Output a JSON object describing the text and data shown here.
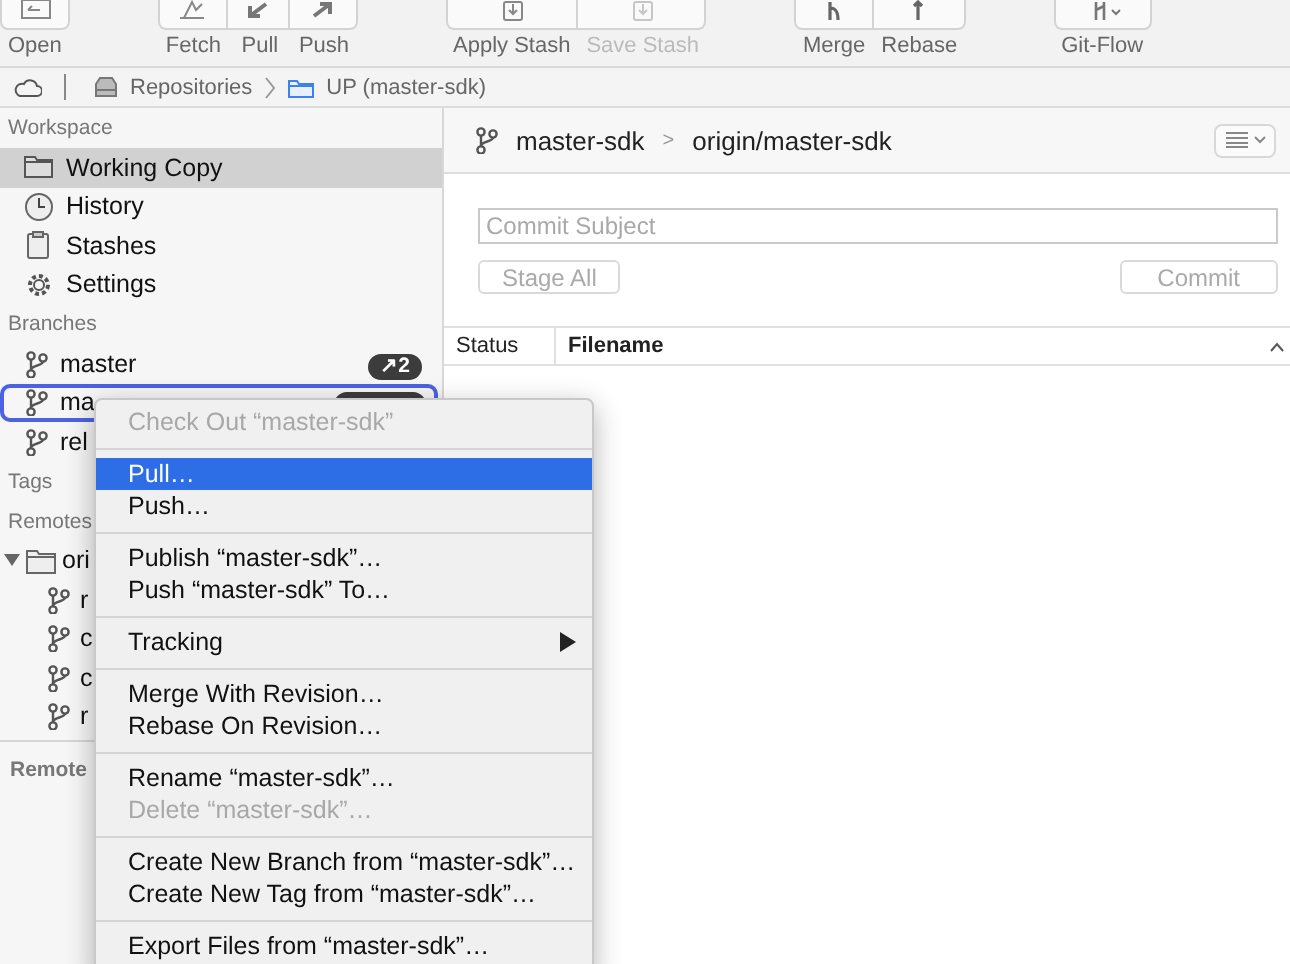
{
  "toolbar": {
    "groups": [
      {
        "buttons": [
          {
            "kind": "open",
            "label": "Open",
            "disabled": false
          }
        ]
      },
      {
        "buttons": [
          {
            "kind": "fetch",
            "label": "Fetch",
            "disabled": false
          },
          {
            "kind": "pull",
            "label": "Pull",
            "disabled": false
          },
          {
            "kind": "push",
            "label": "Push",
            "disabled": false
          }
        ]
      },
      {
        "buttons": [
          {
            "kind": "stash",
            "label": "Apply Stash",
            "disabled": false
          },
          {
            "kind": "stash",
            "label": "Save Stash",
            "disabled": true
          }
        ]
      },
      {
        "buttons": [
          {
            "kind": "merge",
            "label": "Merge",
            "disabled": false
          },
          {
            "kind": "rebase",
            "label": "Rebase",
            "disabled": false
          }
        ]
      },
      {
        "buttons": [
          {
            "kind": "gitflow",
            "label": "Git-Flow",
            "disabled": false
          }
        ]
      }
    ]
  },
  "breadcrumb": {
    "items": [
      {
        "kind": "drive",
        "label": "Repositories"
      },
      {
        "kind": "folder",
        "label": "UP (master-sdk)"
      }
    ]
  },
  "sidebar": {
    "workspace": {
      "title": "Workspace",
      "items": [
        {
          "kind": "folder",
          "label": "Working Copy",
          "selected": true
        },
        {
          "kind": "history",
          "label": "History",
          "selected": false
        },
        {
          "kind": "stashes",
          "label": "Stashes",
          "selected": false
        },
        {
          "kind": "settings",
          "label": "Settings",
          "selected": false
        }
      ]
    },
    "branches": {
      "title": "Branches",
      "items": [
        {
          "label": "master",
          "badge": "↗2",
          "head_badge": false,
          "focused": false
        },
        {
          "label": "ma",
          "head_badge": true,
          "focused": true
        },
        {
          "label": "rel",
          "head_badge": false,
          "focused": false
        }
      ]
    },
    "tags": {
      "title": "Tags"
    },
    "remotes": {
      "title": "Remotes",
      "items": [
        {
          "label": "ori",
          "expanded": true,
          "children": [
            {
              "label": "r"
            },
            {
              "label": "c"
            },
            {
              "label": "c"
            },
            {
              "label": "r"
            }
          ]
        }
      ]
    },
    "remote_accounts": {
      "title": "Remote"
    }
  },
  "main": {
    "upstream": {
      "branch": "master-sdk",
      "separator": ">",
      "remote": "origin/master-sdk"
    },
    "commit": {
      "placeholder": "Commit Subject",
      "stage_button": {
        "label": "Stage All",
        "disabled": true
      },
      "commit_button": {
        "label": "Commit",
        "disabled": true
      }
    },
    "table": {
      "columns": [
        {
          "label": "Status",
          "sorted": false
        },
        {
          "label": "Filename",
          "sorted": true
        }
      ]
    }
  },
  "context_menu": {
    "items": [
      {
        "kind": "item",
        "label": "Check Out “master-sdk”",
        "disabled": true,
        "selected": false
      },
      {
        "kind": "separator"
      },
      {
        "kind": "item",
        "label": "Pull…",
        "disabled": false,
        "selected": true
      },
      {
        "kind": "item",
        "label": "Push…",
        "disabled": false,
        "selected": false
      },
      {
        "kind": "separator"
      },
      {
        "kind": "item",
        "label": "Publish “master-sdk”…",
        "disabled": false,
        "selected": false
      },
      {
        "kind": "item",
        "label": "Push “master-sdk” To…",
        "disabled": false,
        "selected": false
      },
      {
        "kind": "separator"
      },
      {
        "kind": "submenu",
        "label": "Tracking",
        "disabled": false,
        "selected": false
      },
      {
        "kind": "separator"
      },
      {
        "kind": "item",
        "label": "Merge With Revision…",
        "disabled": false,
        "selected": false
      },
      {
        "kind": "item",
        "label": "Rebase On Revision…",
        "disabled": false,
        "selected": false
      },
      {
        "kind": "separator"
      },
      {
        "kind": "item",
        "label": "Rename “master-sdk”…",
        "disabled": false,
        "selected": false
      },
      {
        "kind": "item",
        "label": "Delete “master-sdk”…",
        "disabled": true,
        "selected": false
      },
      {
        "kind": "separator"
      },
      {
        "kind": "item",
        "label": "Create New Branch from “master-sdk”…",
        "disabled": false,
        "selected": false
      },
      {
        "kind": "item",
        "label": "Create New Tag from “master-sdk”…",
        "disabled": false,
        "selected": false
      },
      {
        "kind": "separator"
      },
      {
        "kind": "item",
        "label": "Export Files from “master-sdk”…",
        "disabled": false,
        "selected": false
      }
    ]
  }
}
